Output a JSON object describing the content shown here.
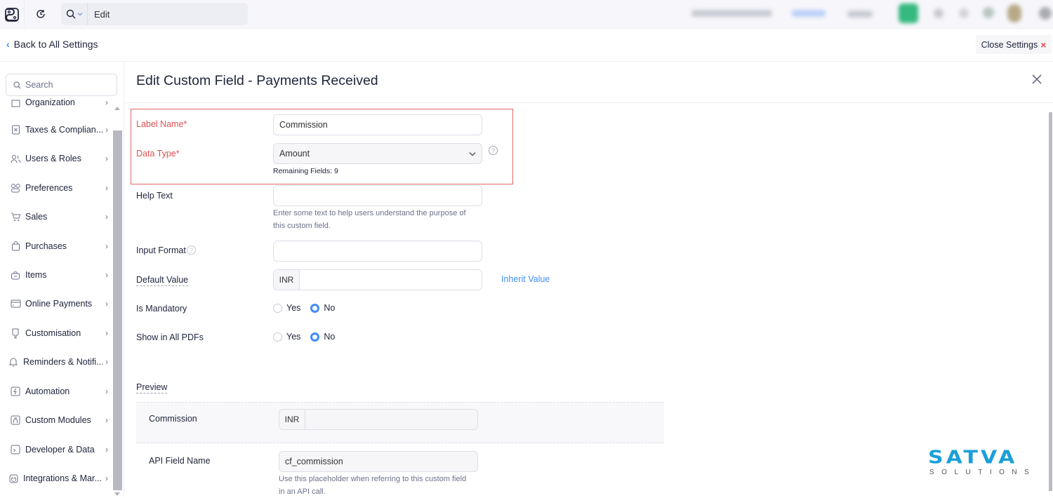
{
  "topbar": {
    "search_scope_icon": "search-icon",
    "search_value": "Edit",
    "history_icon": "history-icon"
  },
  "back_link": "Back to All Settings",
  "close_settings": "Close Settings",
  "sidebar": {
    "search_placeholder": "Search",
    "items": [
      {
        "label": "Organization",
        "icon": "building-icon"
      },
      {
        "label": "Taxes & Complian...",
        "icon": "tax-icon"
      },
      {
        "label": "Users & Roles",
        "icon": "users-icon"
      },
      {
        "label": "Preferences",
        "icon": "preferences-icon"
      },
      {
        "label": "Sales",
        "icon": "cart-icon"
      },
      {
        "label": "Purchases",
        "icon": "bag-icon"
      },
      {
        "label": "Items",
        "icon": "box-icon"
      },
      {
        "label": "Online Payments",
        "icon": "card-icon"
      },
      {
        "label": "Customisation",
        "icon": "brush-icon"
      },
      {
        "label": "Reminders & Notifi...",
        "icon": "bell-icon"
      },
      {
        "label": "Automation",
        "icon": "bolt-icon"
      },
      {
        "label": "Custom Modules",
        "icon": "modules-icon"
      },
      {
        "label": "Developer & Data",
        "icon": "terminal-icon"
      },
      {
        "label": "Integrations & Mar...",
        "icon": "plug-icon"
      }
    ]
  },
  "form": {
    "title": "Edit Custom Field - Payments Received",
    "label_name": {
      "label": "Label Name*",
      "value": "Commission"
    },
    "data_type": {
      "label": "Data Type*",
      "value": "Amount",
      "remaining": "Remaining Fields: 9"
    },
    "help_text": {
      "label": "Help Text",
      "value": "",
      "hint_line1": "Enter some text to help users understand the purpose of",
      "hint_line2": "this custom field."
    },
    "input_format": {
      "label": "Input Format",
      "value": ""
    },
    "default_value": {
      "label": "Default Value",
      "prefix": "INR",
      "value": "",
      "link": "Inherit Value"
    },
    "is_mandatory": {
      "label": "Is Mandatory",
      "options": [
        "Yes",
        "No"
      ],
      "selected": "No"
    },
    "show_in_pdfs": {
      "label": "Show in All PDFs",
      "options": [
        "Yes",
        "No"
      ],
      "selected": "No"
    },
    "preview": {
      "heading": "Preview",
      "field_label": "Commission",
      "prefix": "INR",
      "value": ""
    },
    "api_field": {
      "label": "API Field Name",
      "value": "cf_commission",
      "hint_line1": "Use this placeholder when referring to this custom field",
      "hint_line2": "in an API call."
    }
  },
  "watermark": {
    "main": "SATVA",
    "sub": "SOLUTIONS"
  },
  "colors": {
    "accent": "#408dfb",
    "required": "#e0504f",
    "highlight_border": "#e06565",
    "brand": "#1b9fd8"
  }
}
